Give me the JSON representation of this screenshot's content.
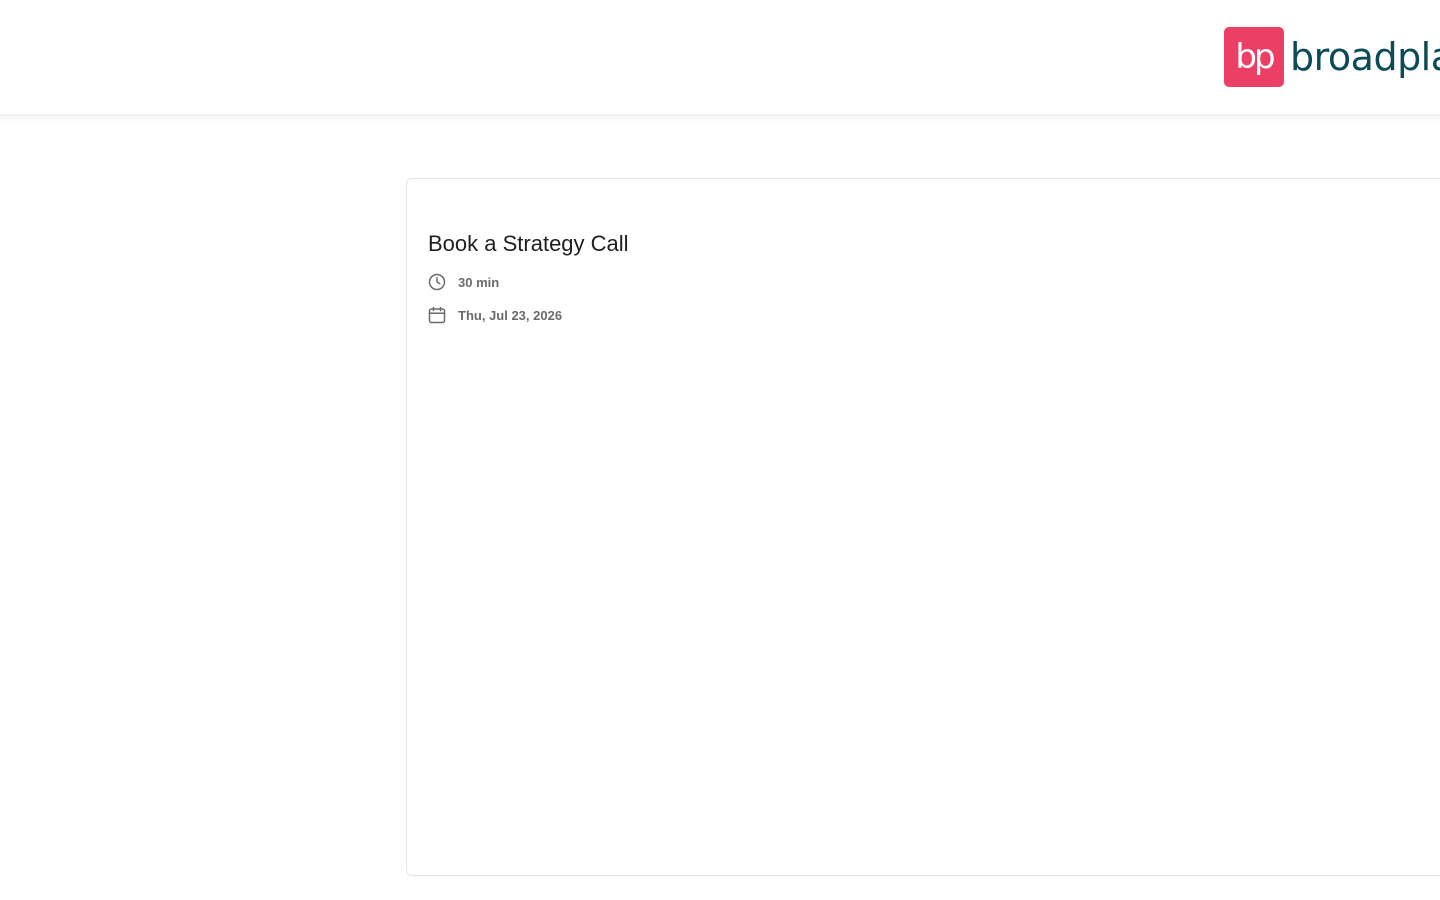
{
  "header": {
    "logo": {
      "mark_text": "bp",
      "wordmark": "broadplace",
      "brand_color": "#ec3f66",
      "wordmark_color": "#0b4a57"
    }
  },
  "booking": {
    "title": "Book a Strategy Call",
    "duration": {
      "icon": "clock-icon",
      "text": "30 min"
    },
    "date": {
      "icon": "calendar-icon",
      "text": "Thu, Jul 23, 2026"
    }
  }
}
